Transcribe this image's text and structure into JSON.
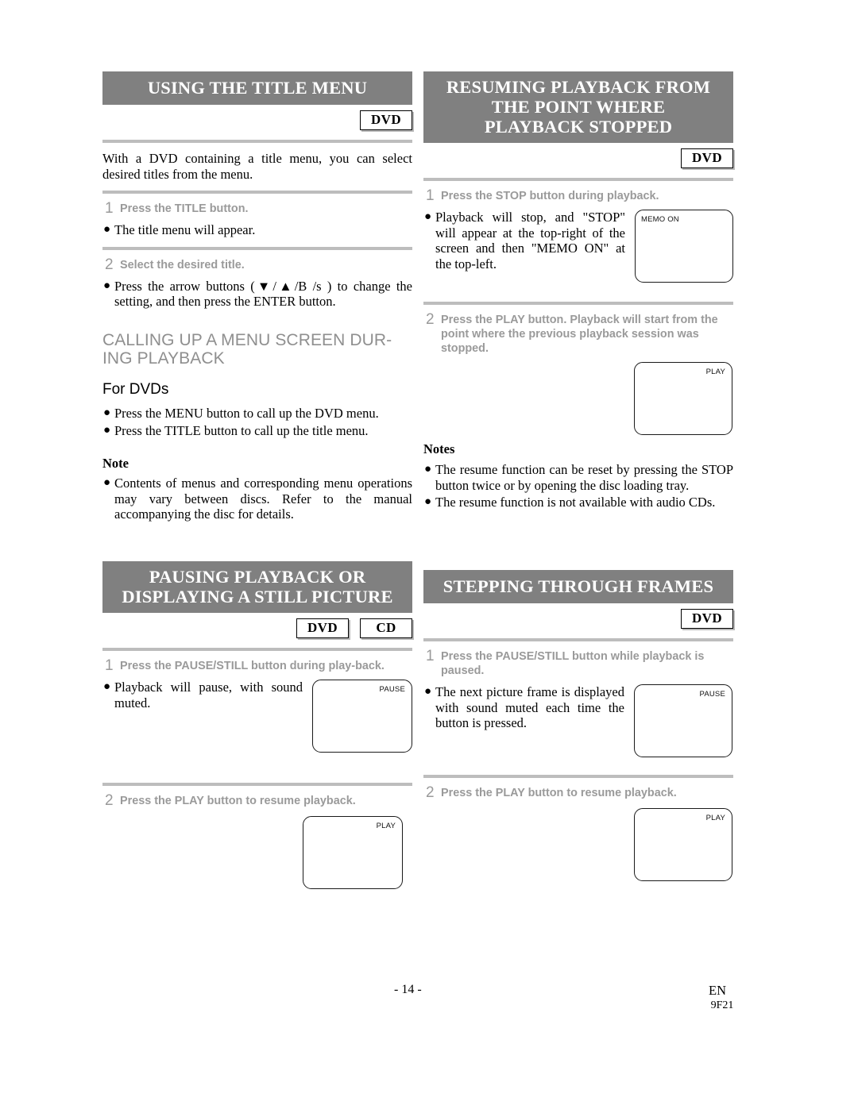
{
  "page": {
    "number": "- 14 -",
    "language_code": "EN",
    "part_number": "9F21"
  },
  "sections": {
    "title_menu": {
      "heading": "USING THE TITLE MENU",
      "badges": [
        "DVD"
      ],
      "intro": "With a DVD containing a title menu, you can select desired titles from the menu.",
      "step1": {
        "num": "1",
        "text": "Press the TITLE button."
      },
      "step1_bullet": "The title menu will appear.",
      "step2": {
        "num": "2",
        "text": "Select the desired title."
      },
      "step2_bullet": "Press the arrow buttons (▼/▲/B /s ) to change the setting, and then press the ENTER button."
    },
    "menu_screen": {
      "heading": "CALLING UP A MENU SCREEN DUR-\nING PLAYBACK",
      "heading_line1": "CALLING UP A MENU SCREEN DUR-",
      "heading_line2": "ING PLAYBACK",
      "subheading": "For DVDs",
      "bullets": [
        "Press the MENU button to call up the DVD menu.",
        "Press the TITLE button to call up the title menu."
      ],
      "note_label": "Note",
      "note_bullets": [
        "Contents of menus and corresponding menu operations may vary between discs. Refer to the manual accompanying the disc for details."
      ]
    },
    "resuming": {
      "heading_line1": "RESUMING PLAYBACK FROM",
      "heading_line2": "THE POINT WHERE",
      "heading_line3": "PLAYBACK STOPPED",
      "badges": [
        "DVD"
      ],
      "step1": {
        "num": "1",
        "text": "Press the STOP button during playback."
      },
      "step1_bullet": "Playback will stop, and \"STOP\" will appear at the top-right of the screen and then \"MEMO ON\" at the top-left.",
      "screen1_label": "MEMO ON",
      "step2": {
        "num": "2",
        "text": "Press the PLAY button. Playback will start from the point where the previous playback session was stopped."
      },
      "screen2_label": "PLAY",
      "notes_label": "Notes",
      "notes": [
        "The resume function can be reset by pressing the STOP button twice or by opening the disc loading tray.",
        "The resume function is not available with audio CDs."
      ]
    },
    "pausing": {
      "heading_line1": "PAUSING PLAYBACK OR",
      "heading_line2": "DISPLAYING A STILL PICTURE",
      "badges": [
        "DVD",
        "CD"
      ],
      "step1": {
        "num": "1",
        "text": "Press the PAUSE/STILL button during play-back."
      },
      "step1_bullet": "Playback will pause, with sound muted.",
      "screen1_label": "PAUSE",
      "step2": {
        "num": "2",
        "text": "Press the PLAY button to resume playback."
      },
      "screen2_label": "PLAY"
    },
    "stepping": {
      "heading": "STEPPING THROUGH FRAMES",
      "badges": [
        "DVD"
      ],
      "step1": {
        "num": "1",
        "text": "Press the PAUSE/STILL button while playback is paused."
      },
      "step1_bullet": "The next picture frame is displayed with sound muted each time the button is pressed.",
      "screen1_label": "PAUSE",
      "step2": {
        "num": "2",
        "text": "Press the PLAY button to resume playback."
      },
      "screen2_label": "PLAY"
    }
  }
}
